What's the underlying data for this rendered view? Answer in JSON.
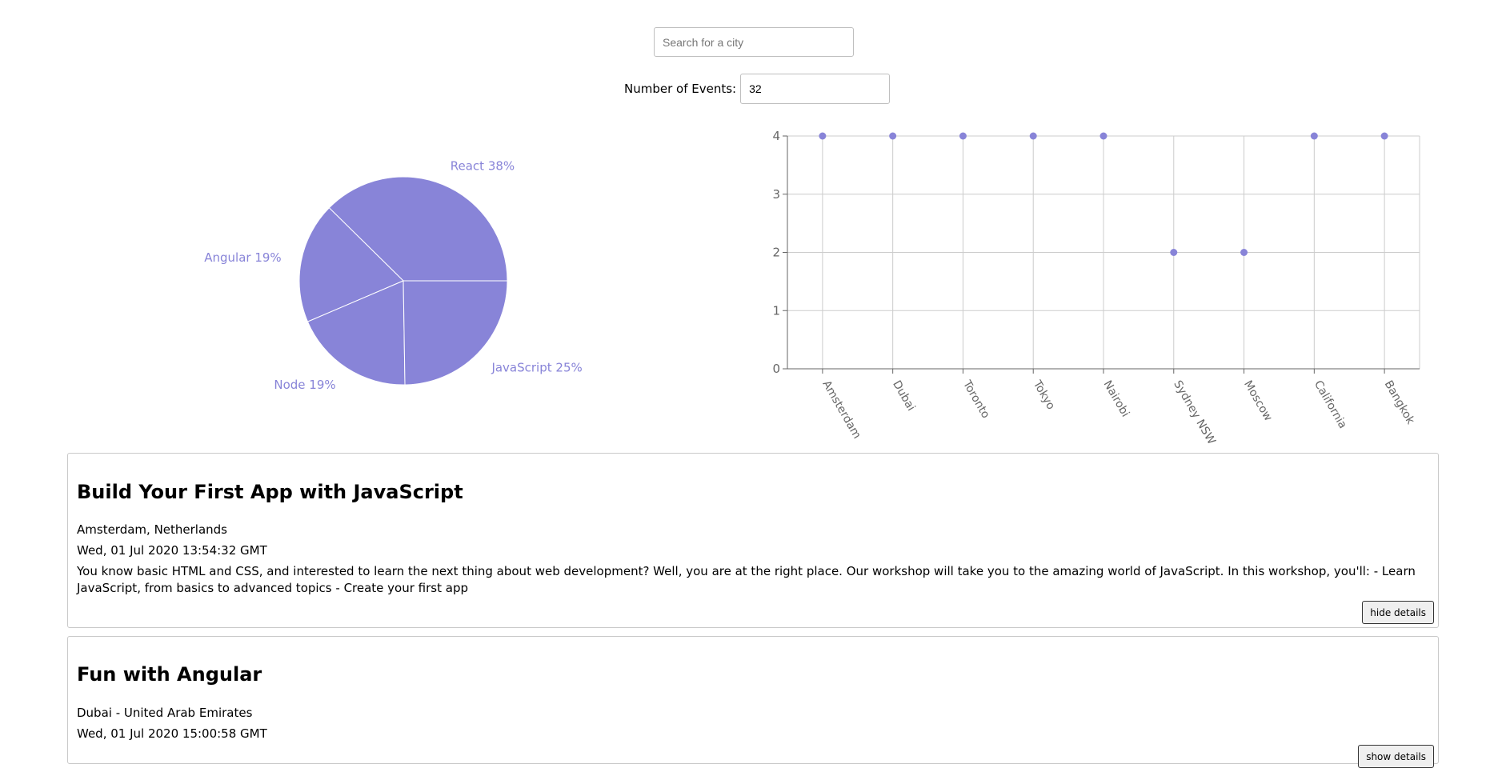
{
  "search": {
    "placeholder": "Search for a city",
    "value": ""
  },
  "number_of_events": {
    "label": "Number of Events:",
    "value": "32"
  },
  "colors": {
    "accent": "#8884d8",
    "grid": "#cccccc",
    "axis": "#666666"
  },
  "chart_data": [
    {
      "type": "pie",
      "labels": [
        "React",
        "Angular",
        "Node",
        "JavaScript"
      ],
      "values": [
        38,
        19,
        19,
        25
      ],
      "slice_labels": [
        "React 38%",
        "Angular 19%",
        "Node 19%",
        "JavaScript 25%"
      ],
      "color": "#8884d8"
    },
    {
      "type": "scatter",
      "categories": [
        "Amsterdam",
        "Dubai",
        "Toronto",
        "Tokyo",
        "Nairobi",
        "Sydney NSW",
        "Moscow",
        "California",
        "Bangkok"
      ],
      "values": [
        4,
        4,
        4,
        4,
        4,
        2,
        2,
        4,
        4
      ],
      "ylim": [
        0,
        4
      ],
      "yticks": [
        "0",
        "1",
        "2",
        "3",
        "4"
      ],
      "grid": true,
      "color": "#8884d8"
    }
  ],
  "events": [
    {
      "title": "Build Your First App with JavaScript",
      "location": "Amsterdam, Netherlands",
      "date": "Wed, 01 Jul 2020 13:54:32 GMT",
      "description": "You know basic HTML and CSS, and interested to learn the next thing about web development? Well, you are at the right place. Our workshop will take you to the amazing world of JavaScript. In this workshop, you'll: - Learn JavaScript, from basics to advanced topics - Create your first app",
      "button": "hide details"
    },
    {
      "title": "Fun with Angular",
      "location": "Dubai - United Arab Emirates",
      "date": "Wed, 01 Jul 2020 15:00:58 GMT",
      "button": "show details"
    }
  ]
}
